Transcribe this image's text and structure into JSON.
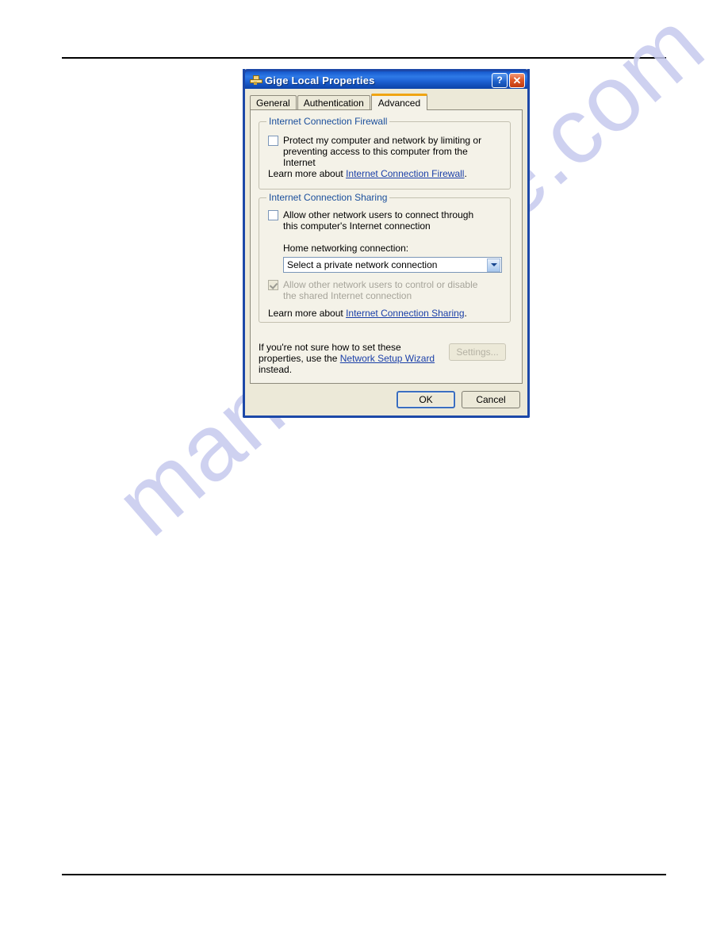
{
  "page": {
    "watermark": "manualshive.com"
  },
  "dialog": {
    "title": "Gige Local Properties",
    "title_icon": "network-connection-icon",
    "help_button": "?",
    "close_button": "✕",
    "tabs": [
      {
        "label": "General",
        "active": false
      },
      {
        "label": "Authentication",
        "active": false
      },
      {
        "label": "Advanced",
        "active": true
      }
    ],
    "firewall_group": {
      "legend": "Internet Connection Firewall",
      "checkbox": {
        "checked": false,
        "label": "Protect my computer and network by limiting or preventing access to this computer from the Internet"
      },
      "learn_more_prefix": "Learn more about ",
      "learn_more_link": "Internet Connection Firewall",
      "learn_more_suffix": "."
    },
    "sharing_group": {
      "legend": "Internet Connection Sharing",
      "checkbox": {
        "checked": false,
        "label": "Allow other network users to connect through this computer's Internet connection"
      },
      "home_networking_label": "Home networking connection:",
      "combo_value": "Select a private network connection",
      "combo_icon": "chevron-down-icon",
      "control_checkbox": {
        "checked": true,
        "disabled": true,
        "label": "Allow other network users to control or disable the shared Internet connection"
      },
      "learn_more_prefix": "Learn more about ",
      "learn_more_link": "Internet Connection Sharing",
      "learn_more_suffix": "."
    },
    "footnote": {
      "prefix": "If you're not sure how to set these properties, use the ",
      "link": "Network Setup Wizard",
      "suffix": " instead."
    },
    "settings_button": "Settings...",
    "ok_button": "OK",
    "cancel_button": "Cancel"
  },
  "colors": {
    "titlebar_blue": "#1c61d4",
    "dialog_border": "#1c48a8",
    "tab_accent_orange": "#f0a513",
    "legend_blue": "#1b4f9c",
    "link_blue": "#1a3fa8",
    "face": "#ece9d8",
    "panel": "#f4f2e8",
    "watermark": "#c6c9ee"
  }
}
